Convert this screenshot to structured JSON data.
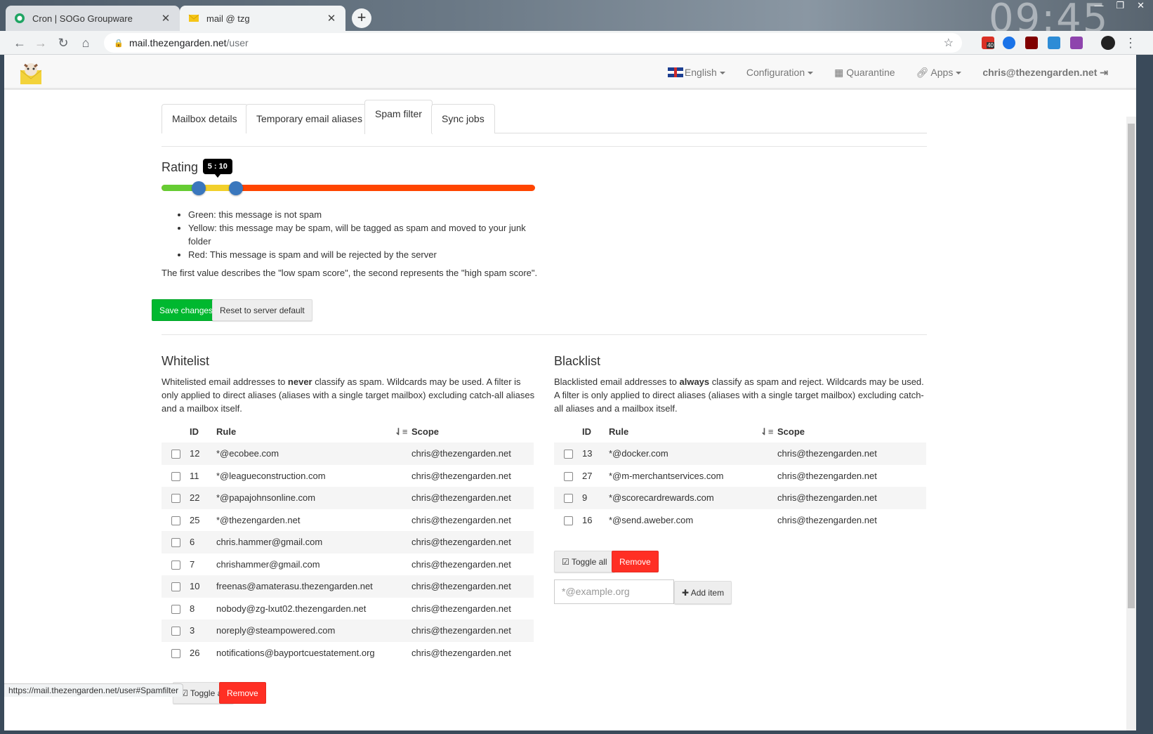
{
  "browser": {
    "tabs": [
      {
        "title": "Cron | SOGo Groupware",
        "favicon": "sogo-icon"
      },
      {
        "title": "mail @ tzg",
        "favicon": "envelope-icon"
      }
    ],
    "clock": "09:45",
    "url_host": "mail.thezengarden.net",
    "url_path": "/user",
    "extension_badge": "40",
    "status_url": "https://mail.thezengarden.net/user#Spamfilter"
  },
  "navbar": {
    "language": "English",
    "configuration": "Configuration",
    "quarantine": "Quarantine",
    "apps": "Apps",
    "user": "chris@thezengarden.net"
  },
  "tabs": [
    "Mailbox details",
    "Temporary email aliases",
    "Spam filter",
    "Sync jobs"
  ],
  "rating": {
    "title": "Rating",
    "low": 5,
    "high": 10,
    "max": 50,
    "tooltip": "5 : 10",
    "legend": [
      "Green: this message is not spam",
      "Yellow: this message may be spam, will be tagged as spam and moved to your junk folder",
      "Red: This message is spam and will be rejected by the server"
    ],
    "note": "The first value describes the \"low spam score\", the second represents the \"high spam score\".",
    "save_label": "Save changes",
    "reset_label": "Reset to server default"
  },
  "whitelist": {
    "title": "Whitelist",
    "desc_pre": "Whitelisted email addresses to ",
    "desc_bold": "never",
    "desc_post": " classify as spam. Wildcards may be used. A filter is only applied to direct aliases (aliases with a single target mailbox) excluding catch-all aliases and a mailbox itself.",
    "columns": [
      "ID",
      "Rule",
      "Scope"
    ],
    "rows": [
      {
        "id": "12",
        "rule": "*@ecobee.com",
        "scope": "chris@thezengarden.net"
      },
      {
        "id": "11",
        "rule": "*@leagueconstruction.com",
        "scope": "chris@thezengarden.net"
      },
      {
        "id": "22",
        "rule": "*@papajohnsonline.com",
        "scope": "chris@thezengarden.net"
      },
      {
        "id": "25",
        "rule": "*@thezengarden.net",
        "scope": "chris@thezengarden.net"
      },
      {
        "id": "6",
        "rule": "chris.hammer@gmail.com",
        "scope": "chris@thezengarden.net"
      },
      {
        "id": "7",
        "rule": "chrishammer@gmail.com",
        "scope": "chris@thezengarden.net"
      },
      {
        "id": "10",
        "rule": "freenas@amaterasu.thezengarden.net",
        "scope": "chris@thezengarden.net"
      },
      {
        "id": "8",
        "rule": "nobody@zg-lxut02.thezengarden.net",
        "scope": "chris@thezengarden.net"
      },
      {
        "id": "3",
        "rule": "noreply@steampowered.com",
        "scope": "chris@thezengarden.net"
      },
      {
        "id": "26",
        "rule": "notifications@bayportcuestatement.org",
        "scope": "chris@thezengarden.net"
      }
    ],
    "toggle_label": "Toggle all",
    "remove_label": "Remove"
  },
  "blacklist": {
    "title": "Blacklist",
    "desc_pre": "Blacklisted email addresses to ",
    "desc_bold": "always",
    "desc_post": " classify as spam and reject. Wildcards may be used. A filter is only applied to direct aliases (aliases with a single target mailbox) excluding catch-all aliases and a mailbox itself.",
    "columns": [
      "ID",
      "Rule",
      "Scope"
    ],
    "rows": [
      {
        "id": "13",
        "rule": "*@docker.com",
        "scope": "chris@thezengarden.net"
      },
      {
        "id": "27",
        "rule": "*@m-merchantservices.com",
        "scope": "chris@thezengarden.net"
      },
      {
        "id": "9",
        "rule": "*@scorecardrewards.com",
        "scope": "chris@thezengarden.net"
      },
      {
        "id": "16",
        "rule": "*@send.aweber.com",
        "scope": "chris@thezengarden.net"
      }
    ],
    "toggle_label": "Toggle all",
    "remove_label": "Remove",
    "input_placeholder": "*@example.org",
    "add_label": "Add item"
  },
  "colors": {
    "green": "#66cc33",
    "yellow": "#f2d02b",
    "red": "#ff4500",
    "save": "#00b82f",
    "remove": "#ff2f24",
    "handle": "#3a77bd"
  }
}
